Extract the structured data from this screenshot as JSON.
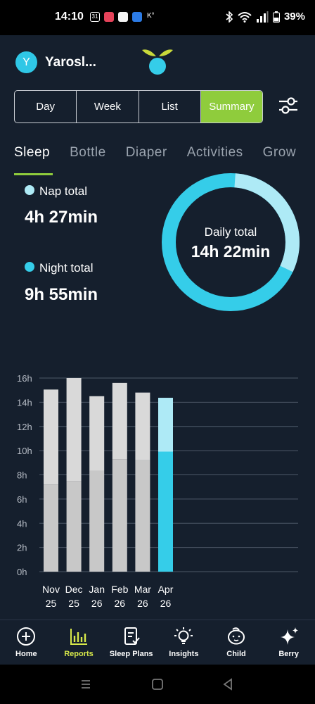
{
  "status": {
    "time": "14:10",
    "battery": "39%",
    "notif_cal": "31",
    "notif_extra": "K°"
  },
  "header": {
    "child_initial": "Y",
    "child_name": "Yarosl..."
  },
  "views": [
    "Day",
    "Week",
    "List",
    "Summary"
  ],
  "active_view": "Summary",
  "tabs": [
    "Sleep",
    "Bottle",
    "Diaper",
    "Activities",
    "Grow"
  ],
  "active_tab": "Sleep",
  "totals": {
    "nap_label": "Nap total",
    "nap_value": "4h 27min",
    "night_label": "Night total",
    "night_value": "9h 55min",
    "daily_label": "Daily total",
    "daily_value": "14h 22min",
    "daily_hours": 14.367,
    "night_hours": 9.917
  },
  "colors": {
    "accent_green": "#8fcc3c",
    "night_blue": "#35cde9",
    "nap_light_blue": "#aeeaf6",
    "past_night": "#c8c8c8",
    "past_nap": "#d9d9d9",
    "background": "#151f2d"
  },
  "chart_data": {
    "type": "bar",
    "stacked": true,
    "categories": [
      "Nov 25",
      "Dec 25",
      "Jan 26",
      "Feb 26",
      "Mar 26",
      "Apr 26"
    ],
    "cat_month": [
      "Nov",
      "Dec",
      "Jan",
      "Feb",
      "Mar",
      "Apr"
    ],
    "cat_year": [
      "25",
      "25",
      "26",
      "26",
      "26",
      "26"
    ],
    "series": [
      {
        "values": [
          7.2,
          7.5,
          8.35,
          9.3,
          9.2,
          9.92
        ]
      },
      {
        "values": [
          7.85,
          8.5,
          6.15,
          6.3,
          5.6,
          4.45
        ]
      }
    ],
    "highlight_index": 5,
    "y_ticks": [
      "0h",
      "2h",
      "4h",
      "6h",
      "8h",
      "10h",
      "12h",
      "14h",
      "16h"
    ],
    "ylim": [
      0,
      16
    ],
    "grid": true
  },
  "nav": [
    {
      "label": "Home",
      "icon": "home-plus-icon",
      "active": false
    },
    {
      "label": "Reports",
      "icon": "reports-chart-icon",
      "active": true
    },
    {
      "label": "Sleep Plans",
      "icon": "sleep-plans-icon",
      "active": false
    },
    {
      "label": "Insights",
      "icon": "insights-bulb-icon",
      "active": false
    },
    {
      "label": "Child",
      "icon": "child-face-icon",
      "active": false
    },
    {
      "label": "Berry",
      "icon": "berry-sparkle-icon",
      "active": false
    }
  ]
}
